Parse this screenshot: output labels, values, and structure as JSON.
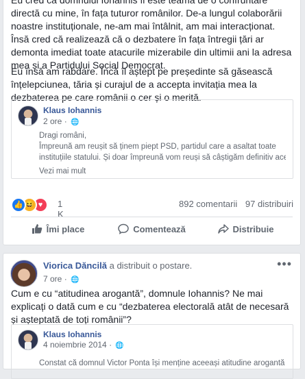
{
  "post1": {
    "paragraph1": "Eu cred că domnului Iohannis îi este teamă de o confruntare directă cu mine, în fața tuturor românilor. De-a lungul colaborării noastre instituționale, ne-am mai întâlnit, am mai interacționat. Însă cred că realizează că o dezbatere în fața întregii țări ar demonta imediat toate atacurile mizerabile din ultimii ani la adresa mea și a Partidului Social Democrat.",
    "paragraph2": "Eu însă am rabdare. Încă îl aștept pe președinte să găsească înțelepciunea, tăria și curajul de a accepta invitația mea la dezbaterea pe care românii o cer și o merită.",
    "shared": {
      "author": "Klaus Iohannis",
      "time": "2 ore",
      "lines": [
        "Dragi români,",
        "Împreună am reușit să ținem piept PSD, partidul care a asaltat toate",
        "instituțiile statului. Și doar împreună vom reuși să câștigăm definitiv aceas..."
      ],
      "see_more": "Vezi mai mult"
    },
    "reaction_count": "1 K",
    "comments": "892 comentarii",
    "shares": "97 distribuiri",
    "actions": {
      "like": "Îmi place",
      "comment": "Comentează",
      "share": "Distribuie"
    }
  },
  "post2": {
    "author": "Viorica Dăncilă",
    "action_text": "a distribuit o postare.",
    "time": "7 ore",
    "more": "•••",
    "text": "Cum e cu “atitudinea arogantă”, domnule Iohannis? Ne mai explicați o dată cum e cu “dezbaterea electorală atât de necesară și așteptată de toți românii”?",
    "shared": {
      "author": "Klaus Iohannis",
      "time": "4 noiembrie 2014",
      "line": "Constat că domnul Victor Ponta își menține aceeași atitudine arogantă cu"
    }
  },
  "colors": {
    "link": "#385898",
    "like_blue": "#1877f2",
    "love_red": "#f33e58",
    "haha_yellow": "#f7b125"
  }
}
